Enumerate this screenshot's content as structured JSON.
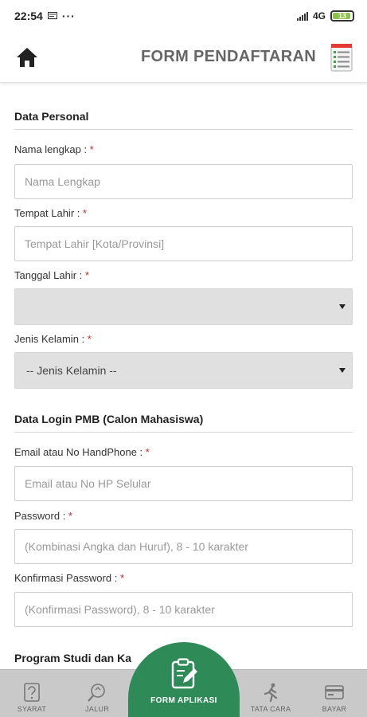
{
  "status_bar": {
    "time": "22:54",
    "dots": "···",
    "network": "4G",
    "battery": "13"
  },
  "header": {
    "title": "FORM PENDAFTARAN"
  },
  "sections": {
    "personal": "Data Personal",
    "login": "Data Login PMB (Calon Mahasiswa)",
    "program": "Program Studi dan Ka"
  },
  "fields": {
    "nama": {
      "label": "Nama lengkap : ",
      "placeholder": "Nama Lengkap"
    },
    "tempat_lahir": {
      "label": "Tempat Lahir : ",
      "placeholder": "Tempat Lahir [Kota/Provinsi]"
    },
    "tanggal_lahir": {
      "label": "Tanggal Lahir : ",
      "value": ""
    },
    "jenis_kelamin": {
      "label": "Jenis Kelamin : ",
      "value": "-- Jenis Kelamin --"
    },
    "email": {
      "label": "Email atau No HandPhone : ",
      "placeholder": "Email atau No HP Selular"
    },
    "password": {
      "label": "Password : ",
      "placeholder": "(Kombinasi Angka dan Huruf), 8 - 10 karakter"
    },
    "konfirmasi": {
      "label": "Konfirmasi Password : ",
      "placeholder": "(Konfirmasi Password), 8 - 10 karakter"
    }
  },
  "required_mark": "*",
  "nav": {
    "syarat": "SYARAT",
    "jalur": "JALUR",
    "form_aplikasi": "FORM APLIKASI",
    "tata_cara": "TATA CARA",
    "bayar": "BAYAR"
  },
  "colors": {
    "accent": "#2e8b57",
    "required": "#c62828",
    "nav_bg": "#c9c9c9"
  }
}
